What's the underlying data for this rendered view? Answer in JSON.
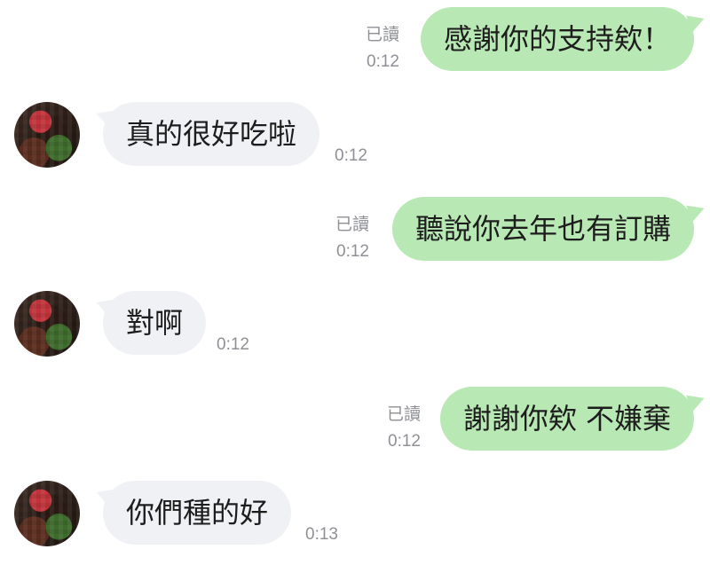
{
  "messages": [
    {
      "direction": "out",
      "text": "感謝你的支持欸！",
      "status": "已讀",
      "time": "0:12"
    },
    {
      "direction": "in",
      "text": "真的很好吃啦",
      "time": "0:12"
    },
    {
      "direction": "out",
      "text": "聽說你去年也有訂購",
      "status": "已讀",
      "time": "0:12"
    },
    {
      "direction": "in",
      "text": "對啊",
      "time": "0:12"
    },
    {
      "direction": "out",
      "text": "謝謝你欸 不嫌棄",
      "status": "已讀",
      "time": "0:12"
    },
    {
      "direction": "in",
      "text": "你們種的好",
      "time": "0:13"
    }
  ],
  "colors": {
    "outgoing_bubble": "#b8e8b3",
    "incoming_bubble": "#f0f1f4",
    "meta_text": "#8e9095"
  }
}
